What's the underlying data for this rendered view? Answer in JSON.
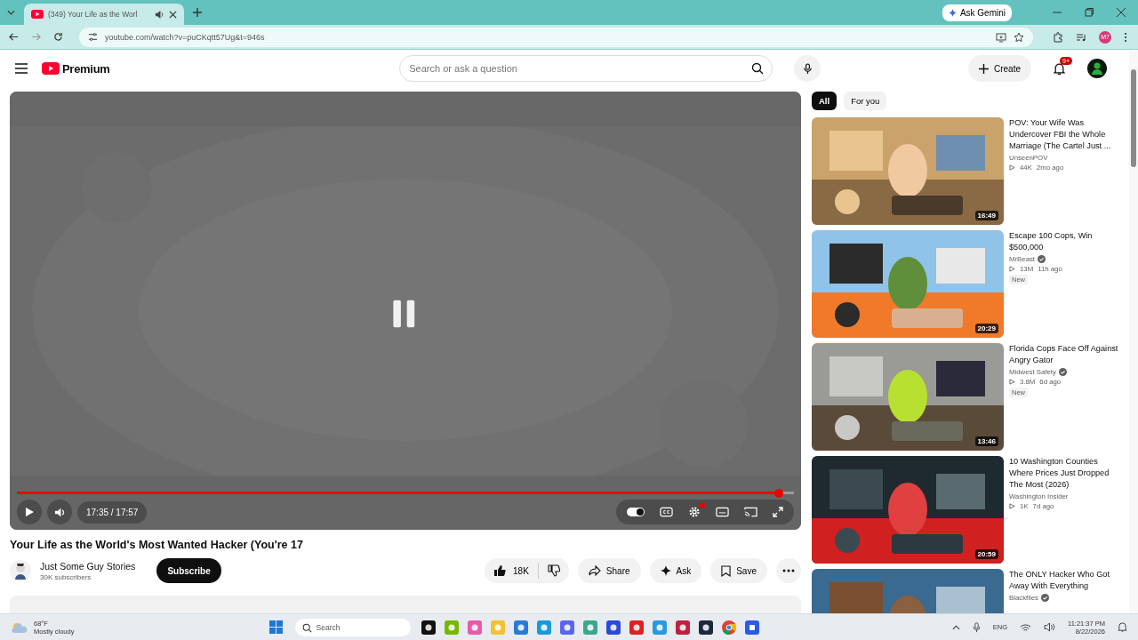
{
  "browser": {
    "tab": {
      "title": "(349) Your Life as the Worl",
      "audio": true
    },
    "url": "youtube.com/watch?v=puCKqtt57Ug&t=946s",
    "ask_gemini": "Ask Gemini",
    "profile": "M7"
  },
  "header": {
    "logo": "Premium",
    "search": {
      "placeholder": "Search or ask a question"
    },
    "create": "Create",
    "notifications": "9+"
  },
  "player": {
    "paused": true,
    "progress": {
      "level": 0.98
    },
    "time": "17:35 / 17:57",
    "autoplay": {
      "on": true
    },
    "quality_badge": true
  },
  "video": {
    "title": "Your Life as the World's Most Wanted Hacker (You're 17",
    "channel": "Just Some Guy Stories",
    "subscribers": "30K subscribers",
    "subscribe": "Subscribe",
    "likes": "18K",
    "share": "Share",
    "ask": "Ask",
    "save": "Save"
  },
  "filters": [
    {
      "label": "All",
      "selected": true
    },
    {
      "label": "For you",
      "selected": false
    }
  ],
  "recommendations": [
    {
      "title": "POV: Your Wife Was Undercover FBI the Whole Marriage (The Cartel Just ...",
      "channel": "UnseenPOV",
      "verified": false,
      "views": "44K",
      "age": "2mo ago",
      "duration": "16:49"
    },
    {
      "title": "Escape 100 Cops, Win $500,000",
      "channel": "MrBeast",
      "verified": true,
      "views": "13M",
      "age": "11h ago",
      "badge": "New",
      "duration": "20:29"
    },
    {
      "title": "Florida Cops Face Off Against Angry Gator",
      "channel": "Midwest Safety",
      "verified": true,
      "views": "3.8M",
      "age": "6d ago",
      "badge": "New",
      "duration": "13:46"
    },
    {
      "title": "10 Washington Counties Where Prices Just Dropped The Most (2026)",
      "channel": "Washington Insider",
      "verified": false,
      "views": "1K",
      "age": "7d ago",
      "duration": "20:59"
    },
    {
      "title": "The ONLY Hacker Who Got Away With Everything",
      "channel": "Blackfiles",
      "verified": true
    }
  ],
  "taskbar": {
    "weather": {
      "temp": "68°F",
      "text": "Mostly cloudy"
    },
    "search": {
      "placeholder": "Search"
    },
    "language": "ENG",
    "time": "11:21:37 PM",
    "date": "8/22/2026"
  }
}
